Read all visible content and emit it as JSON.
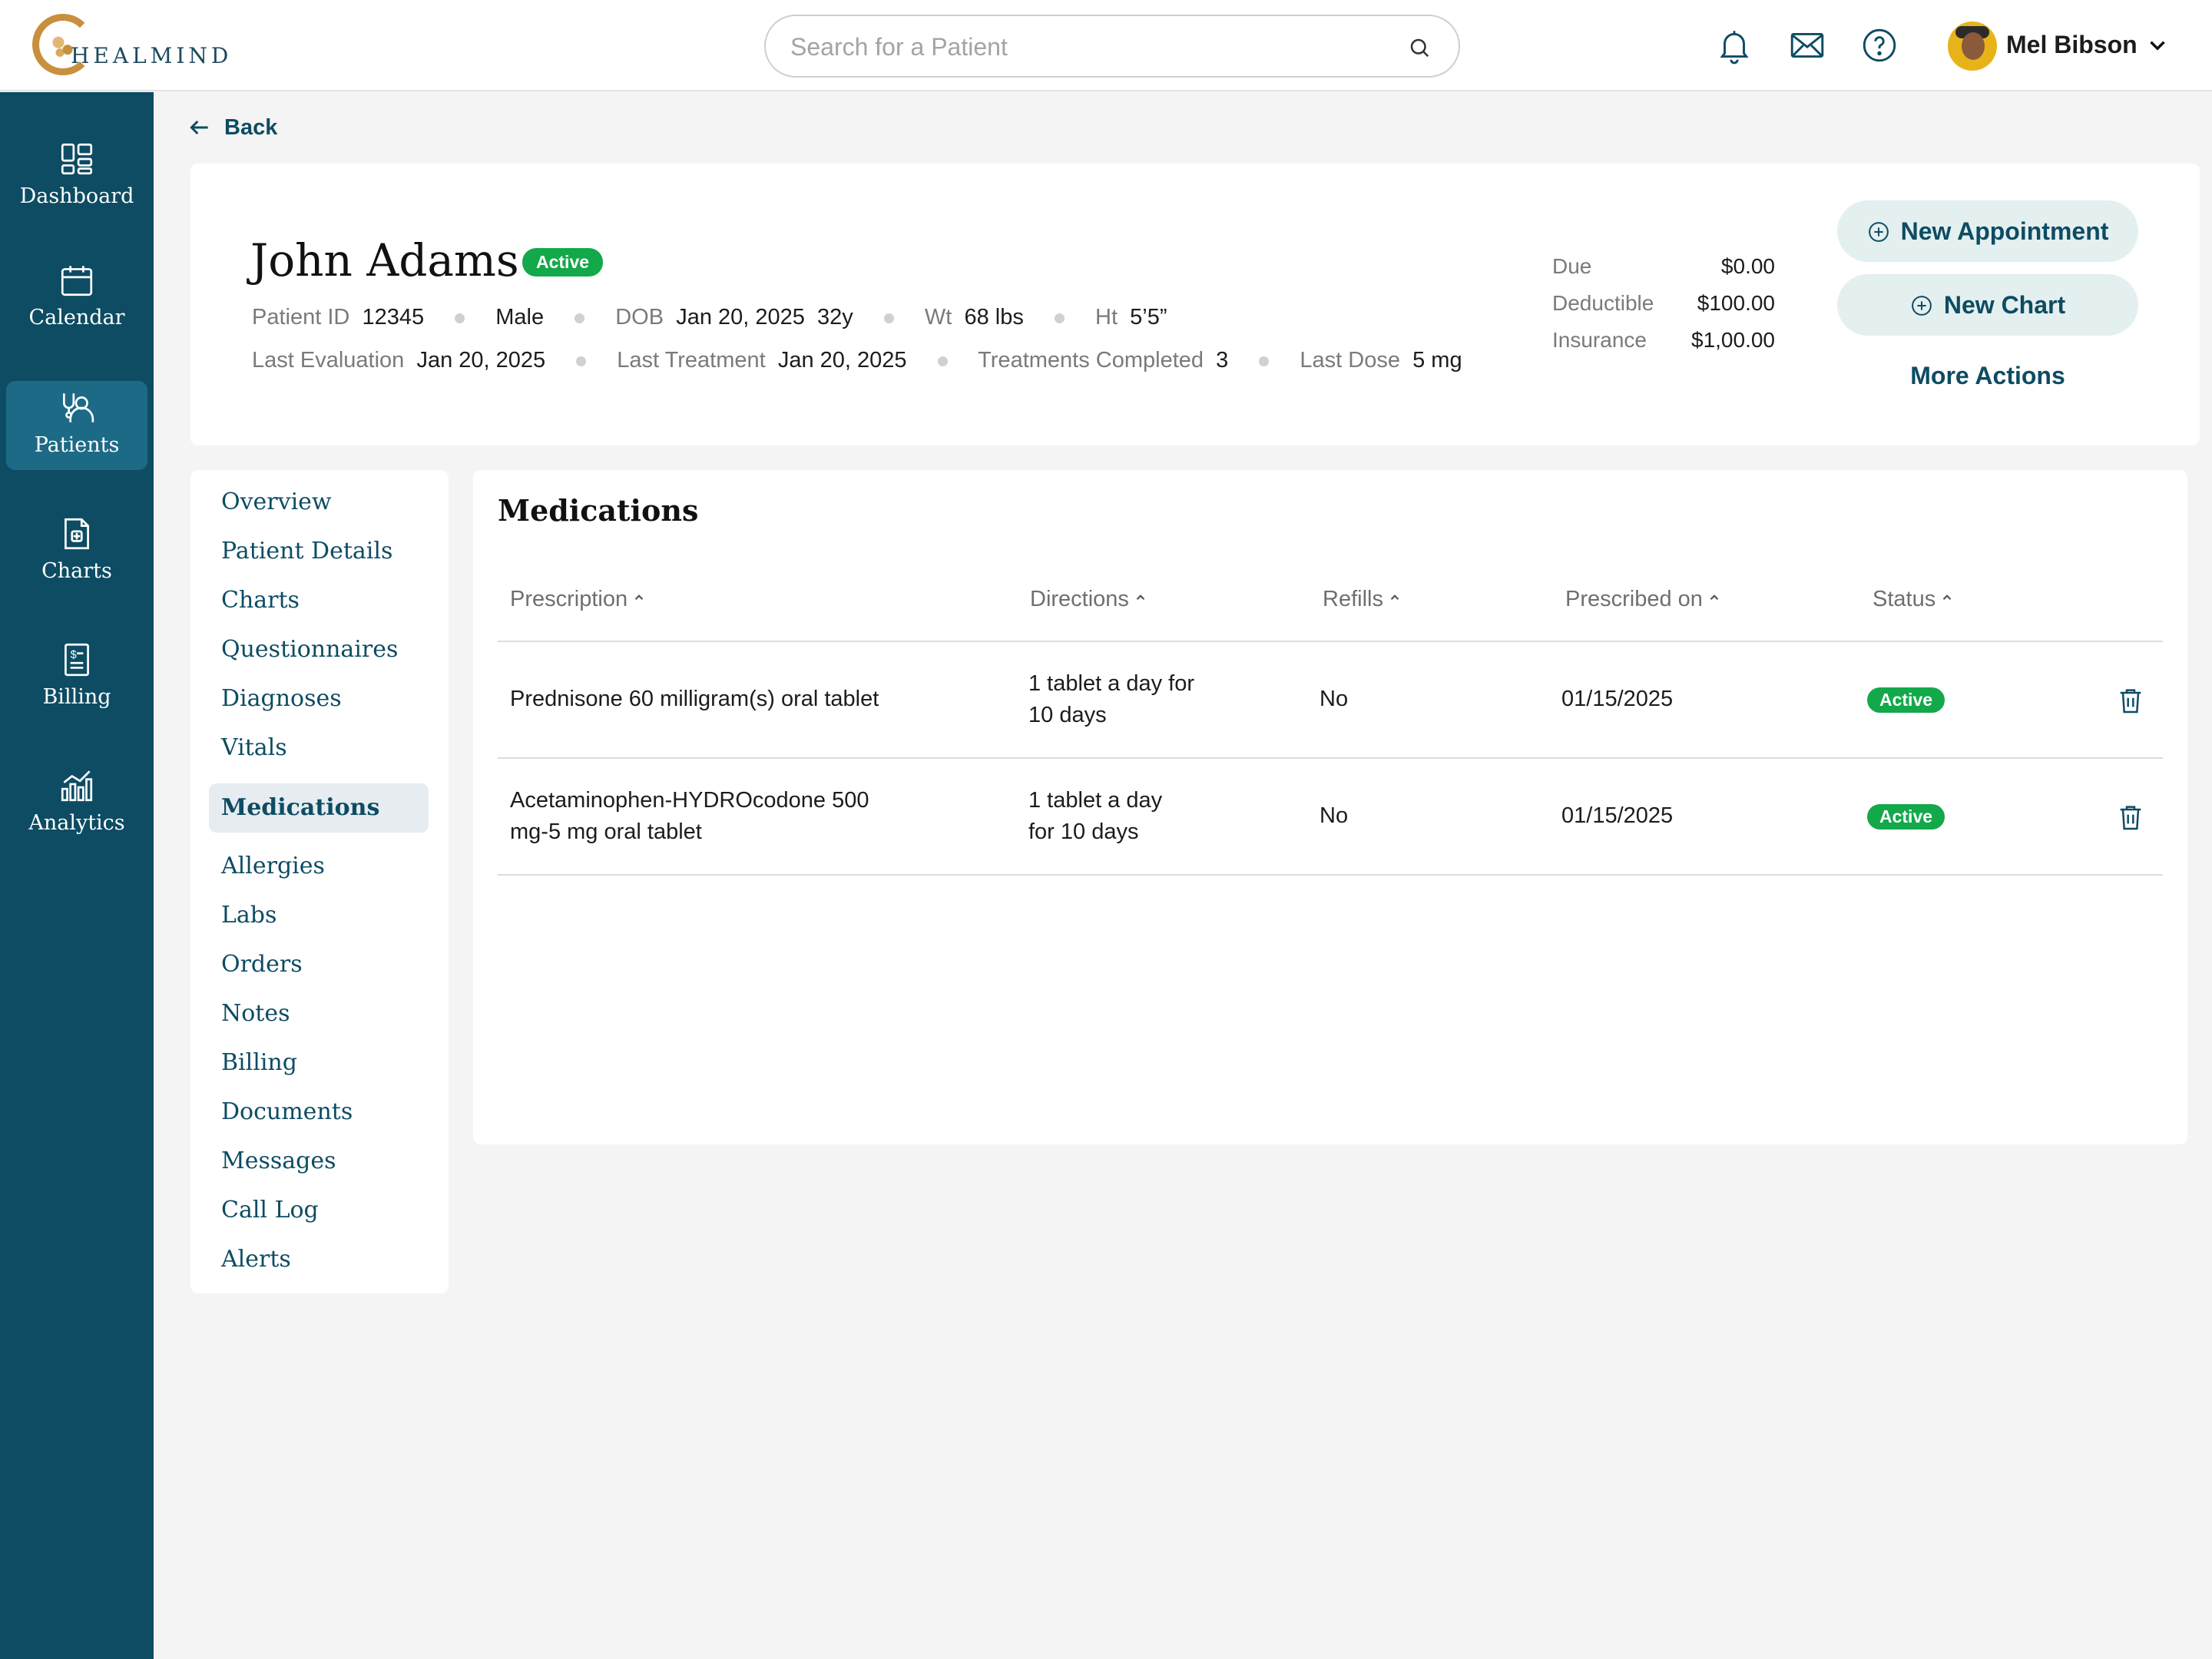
{
  "app": {
    "logo_text": "HEALMIND"
  },
  "search": {
    "placeholder": "Search for a Patient"
  },
  "user": {
    "name": "Mel Bibson"
  },
  "sidebar": {
    "items": [
      {
        "label": "Dashboard",
        "icon": "dashboard-icon"
      },
      {
        "label": "Calendar",
        "icon": "calendar-icon"
      },
      {
        "label": "Patients",
        "icon": "patients-icon"
      },
      {
        "label": "Charts",
        "icon": "charts-icon"
      },
      {
        "label": "Billing",
        "icon": "billing-icon"
      },
      {
        "label": "Analytics",
        "icon": "analytics-icon"
      }
    ],
    "active": "Patients"
  },
  "back": {
    "label": "Back"
  },
  "patient": {
    "name": "John Adams",
    "status": "Active",
    "id_label": "Patient ID",
    "id": "12345",
    "sex": "Male",
    "dob_label": "DOB",
    "dob": "Jan 20, 2025",
    "age": "32y",
    "wt_label": "Wt",
    "wt": "68 lbs",
    "ht_label": "Ht",
    "ht": "5’5”",
    "last_eval_label": "Last Evaluation",
    "last_eval": "Jan 20, 2025",
    "last_treat_label": "Last Treatment",
    "last_treat": "Jan 20, 2025",
    "treat_completed_label": "Treatments Completed",
    "treat_completed": "3",
    "last_dose_label": "Last Dose",
    "last_dose": "5 mg"
  },
  "account": {
    "due_label": "Due",
    "due": "$0.00",
    "deductible_label": "Deductible",
    "deductible": "$100.00",
    "insurance_label": "Insurance",
    "insurance": "$1,00.00"
  },
  "actions": {
    "new_appointment": "New Appointment",
    "new_chart": "New Chart",
    "more_actions": "More Actions"
  },
  "subnav": {
    "items": [
      "Overview",
      "Patient Details",
      "Charts",
      "Questionnaires",
      "Diagnoses",
      "Vitals",
      "Medications",
      "Allergies",
      "Labs",
      "Orders",
      "Notes",
      "Billing",
      "Documents",
      "Messages",
      "Call Log",
      "Alerts"
    ],
    "active": "Medications"
  },
  "medications": {
    "title": "Medications",
    "columns": [
      "Prescription",
      "Directions",
      "Refills",
      "Prescribed on",
      "Status"
    ],
    "rows": [
      {
        "prescription_1": "Prednisone 60 milligram(s) oral tablet",
        "prescription_2": "",
        "directions_1": "1 tablet a day for",
        "directions_2": "10 days",
        "refills": "No",
        "prescribed_on": "01/15/2025",
        "status": "Active"
      },
      {
        "prescription_1": "Acetaminophen-HYDROcodone 500",
        "prescription_2": "mg-5 mg oral tablet",
        "directions_1": "1 tablet a day",
        "directions_2": "for 10 days",
        "refills": "No",
        "prescribed_on": "01/15/2025",
        "status": "Active"
      }
    ]
  },
  "colors": {
    "primary": "#0d4c63",
    "active_badge": "#13a84a",
    "sidebar_active": "#1d6a86",
    "accent_gold": "#c8903e"
  }
}
